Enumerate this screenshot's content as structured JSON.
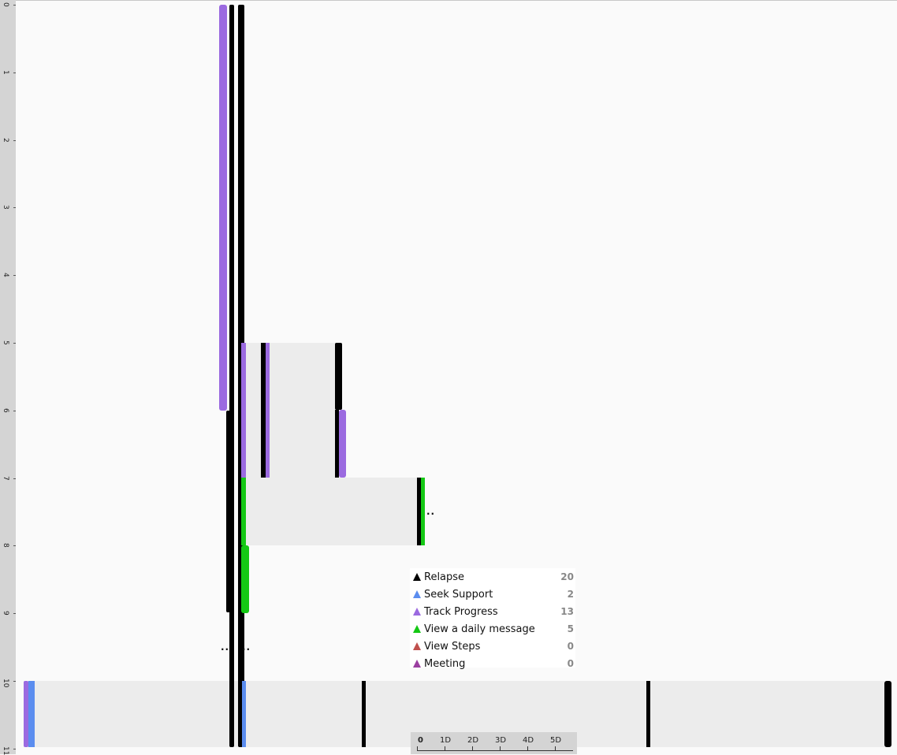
{
  "axis": {
    "ticks": [
      "0",
      "1",
      "2",
      "3",
      "4",
      "5",
      "6",
      "7",
      "8",
      "9",
      "10",
      "11"
    ]
  },
  "legend": [
    {
      "label": "Relapse",
      "count": "20",
      "color": "#000000"
    },
    {
      "label": "Seek Support",
      "count": "2",
      "color": "#5b8def"
    },
    {
      "label": "Track Progress",
      "count": "13",
      "color": "#9b6ae0"
    },
    {
      "label": "View a daily message",
      "count": "5",
      "color": "#14c814"
    },
    {
      "label": "View Steps",
      "count": "0",
      "color": "#c0504d"
    },
    {
      "label": "Meeting",
      "count": "0",
      "color": "#9b3fa0"
    }
  ],
  "scale": {
    "labels": [
      "0",
      "1D",
      "2D",
      "3D",
      "4D",
      "5D"
    ]
  },
  "overflow_markers": [
    "..",
    "..",
    ".."
  ],
  "colors": {
    "relapse": "#000000",
    "seek_support": "#5b8def",
    "track_progress": "#9b6ae0",
    "daily_message": "#14c814",
    "band": "#ececec"
  }
}
